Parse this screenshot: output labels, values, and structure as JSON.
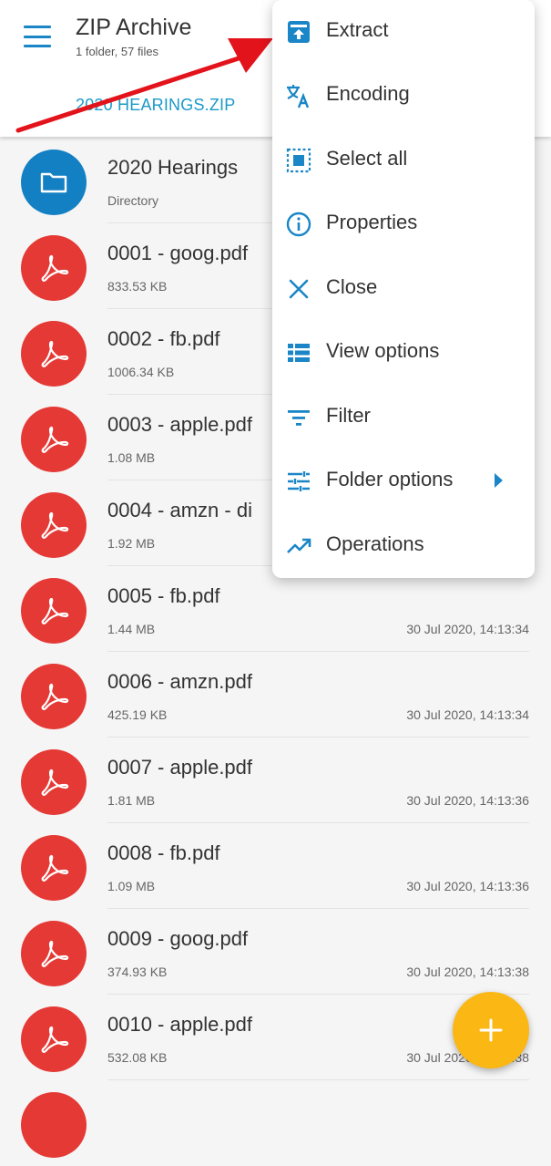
{
  "appbar": {
    "title": "ZIP Archive",
    "subtitle": "1 folder, 57 files",
    "breadcrumb": "2020 HEARINGS.ZIP",
    "menu_icon": "hamburger-menu-icon"
  },
  "files": [
    {
      "name": "2020 Hearings",
      "meta": "Directory",
      "date": "",
      "type": "folder"
    },
    {
      "name": "0001 - goog.pdf",
      "meta": "833.53 KB",
      "date": "",
      "type": "pdf"
    },
    {
      "name": "0002 - fb.pdf",
      "meta": "1006.34 KB",
      "date": "",
      "type": "pdf"
    },
    {
      "name": "0003 - apple.pdf",
      "meta": "1.08 MB",
      "date": "",
      "type": "pdf"
    },
    {
      "name": "0004 - amzn - di",
      "meta": "1.92 MB",
      "date": "",
      "type": "pdf"
    },
    {
      "name": "0005 - fb.pdf",
      "meta": "1.44 MB",
      "date": "30 Jul 2020, 14:13:34",
      "type": "pdf"
    },
    {
      "name": "0006 - amzn.pdf",
      "meta": "425.19 KB",
      "date": "30 Jul 2020, 14:13:34",
      "type": "pdf"
    },
    {
      "name": "0007 - apple.pdf",
      "meta": "1.81 MB",
      "date": "30 Jul 2020, 14:13:36",
      "type": "pdf"
    },
    {
      "name": "0008 - fb.pdf",
      "meta": "1.09 MB",
      "date": "30 Jul 2020, 14:13:36",
      "type": "pdf"
    },
    {
      "name": "0009 - goog.pdf",
      "meta": "374.93 KB",
      "date": "30 Jul 2020, 14:13:38",
      "type": "pdf"
    },
    {
      "name": "0010 - apple.pdf",
      "meta": "532.08 KB",
      "date": "30 Jul 2020, 14:13:38",
      "type": "pdf"
    }
  ],
  "menu": {
    "items": [
      {
        "label": "Extract",
        "icon": "extract-icon"
      },
      {
        "label": "Encoding",
        "icon": "translate-icon"
      },
      {
        "label": "Select all",
        "icon": "select-all-icon"
      },
      {
        "label": "Properties",
        "icon": "info-icon"
      },
      {
        "label": "Close",
        "icon": "close-icon"
      },
      {
        "label": "View options",
        "icon": "view-list-icon"
      },
      {
        "label": "Filter",
        "icon": "filter-icon"
      },
      {
        "label": "Folder options",
        "icon": "tune-icon"
      },
      {
        "label": "Operations",
        "icon": "trending-up-icon"
      }
    ]
  },
  "fab": {
    "icon": "plus-icon"
  },
  "colors": {
    "accent": "#1a86c7",
    "folder": "#1480c4",
    "pdf": "#e53935",
    "fab": "#fbb714",
    "annotation_arrow": "#e3131b"
  }
}
